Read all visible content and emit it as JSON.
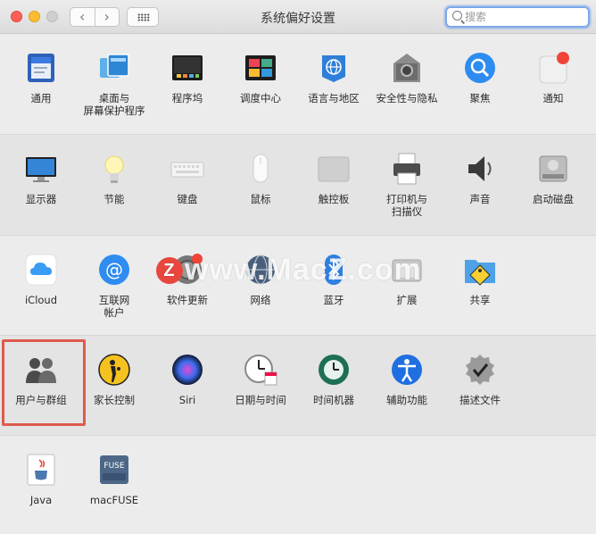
{
  "window": {
    "title": "系统偏好设置"
  },
  "search": {
    "placeholder": "搜索"
  },
  "watermark": {
    "text": "www.MacZ.com",
    "badge": "Z"
  },
  "sections": [
    {
      "items": [
        {
          "label": "通用",
          "icon": "general-icon"
        },
        {
          "label": "桌面与\n屏幕保护程序",
          "icon": "desktop-screensaver-icon"
        },
        {
          "label": "程序坞",
          "icon": "dock-icon"
        },
        {
          "label": "调度中心",
          "icon": "mission-control-icon"
        },
        {
          "label": "语言与地区",
          "icon": "language-region-icon"
        },
        {
          "label": "安全性与隐私",
          "icon": "security-privacy-icon"
        },
        {
          "label": "聚焦",
          "icon": "spotlight-icon"
        },
        {
          "label": "通知",
          "icon": "notifications-icon"
        }
      ]
    },
    {
      "items": [
        {
          "label": "显示器",
          "icon": "displays-icon"
        },
        {
          "label": "节能",
          "icon": "energy-saver-icon"
        },
        {
          "label": "键盘",
          "icon": "keyboard-icon"
        },
        {
          "label": "鼠标",
          "icon": "mouse-icon"
        },
        {
          "label": "触控板",
          "icon": "trackpad-icon"
        },
        {
          "label": "打印机与\n扫描仪",
          "icon": "printers-scanners-icon"
        },
        {
          "label": "声音",
          "icon": "sound-icon"
        },
        {
          "label": "启动磁盘",
          "icon": "startup-disk-icon"
        }
      ]
    },
    {
      "items": [
        {
          "label": "iCloud",
          "icon": "icloud-icon"
        },
        {
          "label": "互联网\n帐户",
          "icon": "internet-accounts-icon"
        },
        {
          "label": "软件更新",
          "icon": "software-update-icon"
        },
        {
          "label": "网络",
          "icon": "network-icon"
        },
        {
          "label": "蓝牙",
          "icon": "bluetooth-icon"
        },
        {
          "label": "扩展",
          "icon": "extensions-icon"
        },
        {
          "label": "共享",
          "icon": "sharing-icon"
        }
      ]
    },
    {
      "items": [
        {
          "label": "用户与群组",
          "icon": "users-groups-icon"
        },
        {
          "label": "家长控制",
          "icon": "parental-controls-icon"
        },
        {
          "label": "Siri",
          "icon": "siri-icon"
        },
        {
          "label": "日期与时间",
          "icon": "date-time-icon"
        },
        {
          "label": "时间机器",
          "icon": "time-machine-icon"
        },
        {
          "label": "辅助功能",
          "icon": "accessibility-icon"
        },
        {
          "label": "描述文件",
          "icon": "profiles-icon"
        }
      ]
    },
    {
      "items": [
        {
          "label": "Java",
          "icon": "java-icon"
        },
        {
          "label": "macFUSE",
          "icon": "macfuse-icon"
        }
      ]
    }
  ],
  "colors": {
    "highlight": "#e05a4e",
    "accent": "#1e7ef6"
  }
}
